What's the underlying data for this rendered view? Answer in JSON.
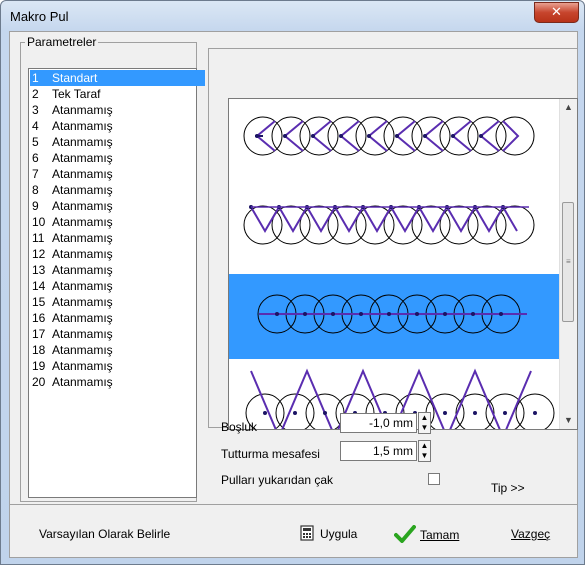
{
  "window": {
    "title": "Makro Pul",
    "close_label": "✕"
  },
  "parameters": {
    "group_label": "Parametreler",
    "items": [
      {
        "num": "1",
        "label": "Standart",
        "selected": true
      },
      {
        "num": "2",
        "label": "Tek Taraf"
      },
      {
        "num": "3",
        "label": "Atanmamış"
      },
      {
        "num": "4",
        "label": "Atanmamış"
      },
      {
        "num": "5",
        "label": "Atanmamış"
      },
      {
        "num": "6",
        "label": "Atanmamış"
      },
      {
        "num": "7",
        "label": "Atanmamış"
      },
      {
        "num": "8",
        "label": "Atanmamış"
      },
      {
        "num": "9",
        "label": "Atanmamış"
      },
      {
        "num": "10",
        "label": "Atanmamış"
      },
      {
        "num": "11",
        "label": "Atanmamış"
      },
      {
        "num": "12",
        "label": "Atanmamış"
      },
      {
        "num": "13",
        "label": "Atanmamış"
      },
      {
        "num": "14",
        "label": "Atanmamış"
      },
      {
        "num": "15",
        "label": "Atanmamış"
      },
      {
        "num": "16",
        "label": "Atanmamış"
      },
      {
        "num": "17",
        "label": "Atanmamış"
      },
      {
        "num": "18",
        "label": "Atanmamış"
      },
      {
        "num": "19",
        "label": "Atanmamış"
      },
      {
        "num": "20",
        "label": "Atanmamış"
      }
    ]
  },
  "settings": {
    "spacing_label": "Boşluk",
    "spacing_value": "-1,0 mm",
    "tack_label": "Tutturma mesafesi",
    "tack_value": "1,5 mm",
    "from_top_label": "Pulları yukarıdan çak",
    "from_top_checked": false,
    "tip_label": "Tip >>"
  },
  "buttons": {
    "default_label": "Varsayılan Olarak Belirle",
    "apply_label": "Uygula",
    "ok_label": "Tamam",
    "cancel_label": "Vazgeç"
  },
  "colors": {
    "selection": "#3399ff",
    "stitch": "#5a2db0",
    "needle_dot": "#1b1464"
  }
}
